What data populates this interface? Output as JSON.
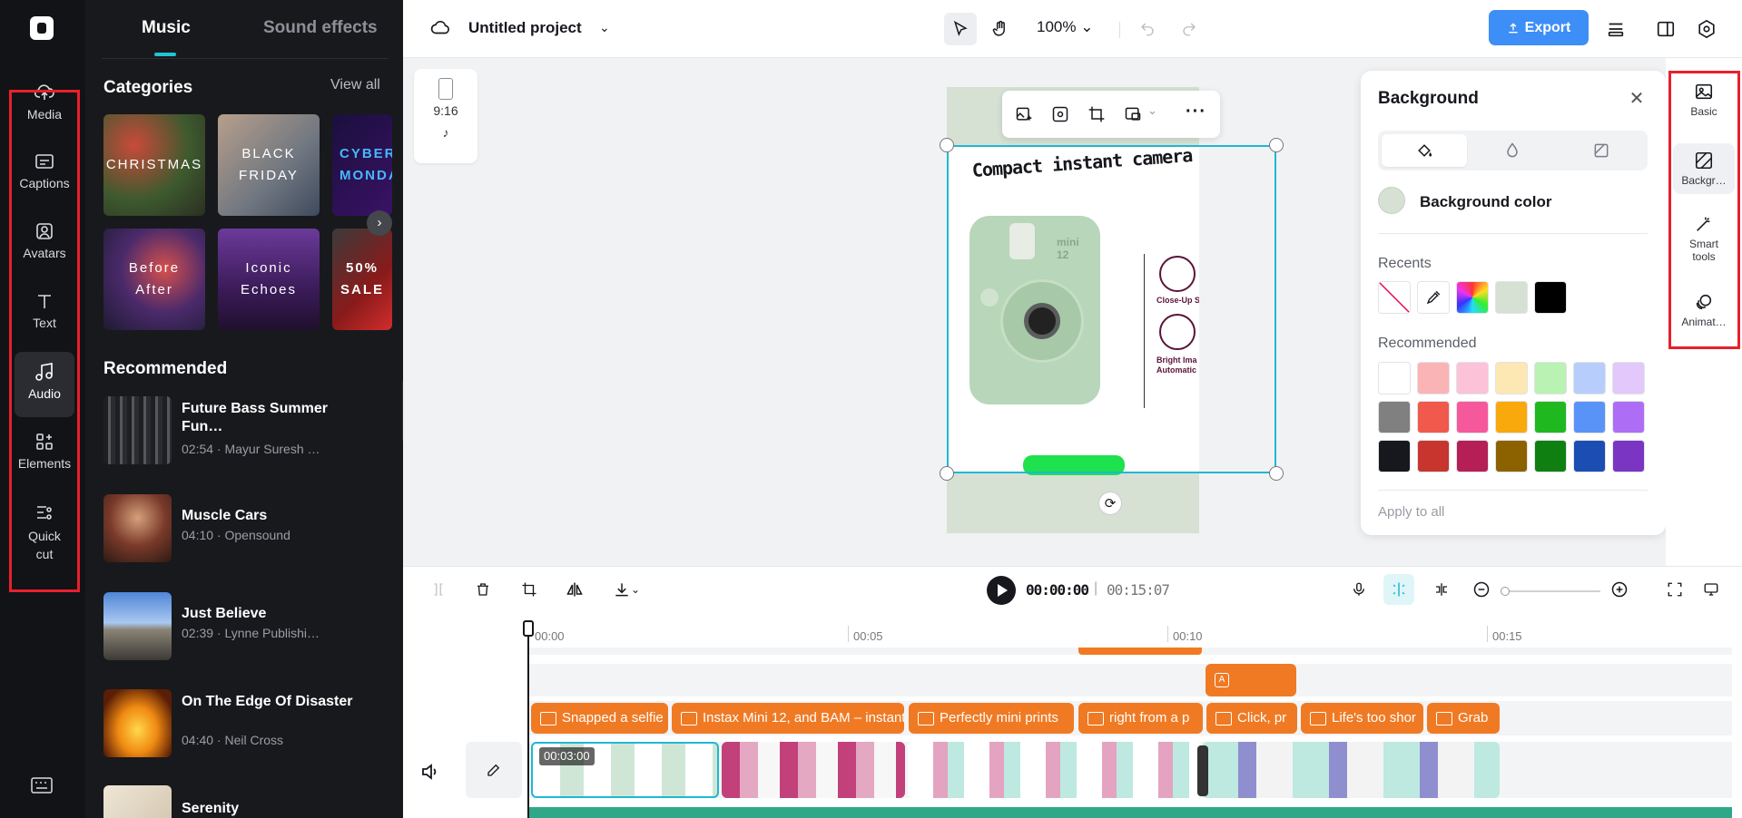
{
  "sidebar": {
    "items": [
      {
        "label": "Media",
        "icon": "cloud-upload-icon"
      },
      {
        "label": "Captions",
        "icon": "captions-icon"
      },
      {
        "label": "Avatars",
        "icon": "avatar-icon"
      },
      {
        "label": "Text",
        "icon": "text-icon"
      },
      {
        "label": "Audio",
        "icon": "music-note-icon",
        "active": true
      },
      {
        "label": "Elements",
        "icon": "elements-icon"
      },
      {
        "label": "Quick cut",
        "icon": "scissors-icon"
      }
    ]
  },
  "panel": {
    "tabs": [
      "Music",
      "Sound effects"
    ],
    "active_tab": "Music",
    "categories_title": "Categories",
    "view_all": "View all",
    "categories": [
      {
        "label": "CHRISTMAS"
      },
      {
        "label": "BLACK FRIDAY"
      },
      {
        "label": "CYBER MONDAY"
      },
      {
        "label": "Before After"
      },
      {
        "label": "Iconic Echoes"
      },
      {
        "label": "50% SALE"
      }
    ],
    "recommended_title": "Recommended",
    "tracks": [
      {
        "title": "Future Bass Summer Fun…",
        "meta": "02:54 · Mayur Suresh …"
      },
      {
        "title": "Muscle Cars",
        "meta": "04:10 · Opensound"
      },
      {
        "title": "Just Believe",
        "meta": "02:39 · Lynne Publishi…"
      },
      {
        "title": "On The Edge Of Disaster",
        "meta": "04:40 · Neil Cross"
      },
      {
        "title": "Serenity",
        "meta": ""
      }
    ]
  },
  "topbar": {
    "project_title": "Untitled project",
    "zoom": "100%",
    "export_label": "Export"
  },
  "canvas": {
    "ratio_label": "9:16",
    "platform_icon": "tiktok-icon",
    "poster_title": "Compact instant camera",
    "side_label_1": "Close-Up S",
    "side_label_2": "Bright Ima Automatic",
    "camera_model": "mini 12"
  },
  "background_panel": {
    "title": "Background",
    "tabs": [
      "color-fill-icon",
      "drop-icon",
      "image-icon"
    ],
    "color_label": "Background color",
    "current_color": "#d6e1d4",
    "recents_label": "Recents",
    "recents": [
      "none",
      "eyedropper",
      "rainbow",
      "#d6e1d4",
      "#000000"
    ],
    "recommended_label": "Recommended",
    "recommended": [
      "#ffffff",
      "#fbb4b6",
      "#fbc2d8",
      "#fde7b3",
      "#b9f2b3",
      "#b7cdfb",
      "#e2c8fb",
      "#808080",
      "#f0594c",
      "#f6599b",
      "#f9a90c",
      "#1fb91f",
      "#5a93f7",
      "#ad6ef5",
      "#16181d",
      "#c8352e",
      "#b51f55",
      "#8c6100",
      "#0f7f12",
      "#1c4db2",
      "#7a35c2"
    ],
    "apply_all": "Apply to all"
  },
  "rightbar": {
    "items": [
      {
        "label": "Basic",
        "icon": "image-icon"
      },
      {
        "label": "Backgr…",
        "icon": "background-icon",
        "active": true
      },
      {
        "label": "Smart tools",
        "icon": "magic-wand-icon"
      },
      {
        "label": "Animat…",
        "icon": "animation-icon"
      }
    ]
  },
  "timeline": {
    "current_time": "00:00:00",
    "separator": "|",
    "total_time": "00:15:07",
    "ruler": [
      "00:00",
      "00:05",
      "00:10",
      "00:15"
    ],
    "clip_time": "00:03:00",
    "captions": [
      "Snapped a selfie",
      "Instax Mini 12, and BAM – instant",
      "Perfectly mini prints",
      "right from a p",
      "Click, pr",
      "Life's too shor",
      "Grab"
    ]
  },
  "colors": {
    "accent": "#3d8ef7",
    "selection": "#1fb8d3",
    "caption": "#f07a24",
    "highlight_box": "#e8202c"
  }
}
